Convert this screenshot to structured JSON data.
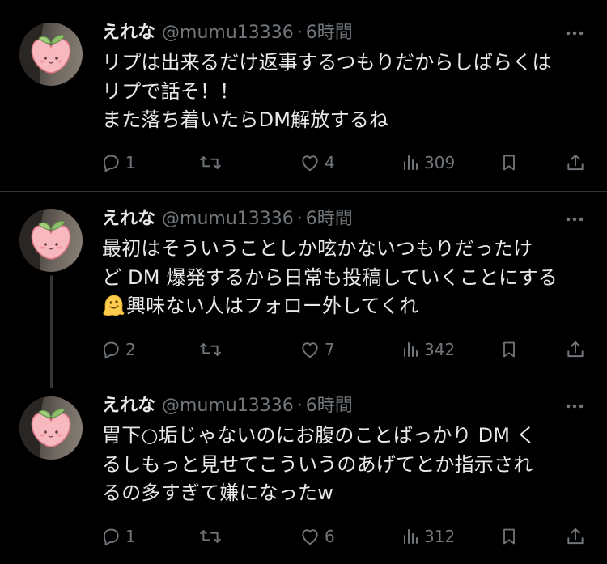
{
  "colors": {
    "background": "#000000",
    "text_primary": "#e7e9ea",
    "text_secondary": "#71767b",
    "divider": "#2f3336",
    "avatar_peach": "#f7b8c0"
  },
  "tweets": [
    {
      "name": "えれな",
      "handle": "@mumu13336",
      "separator": "·",
      "time": "6時間",
      "text": "リプは出来るだけ返事するつもりだからしばらくは\nリプで話そ！！\nまた落ち着いたらDM解放するね",
      "reply_count": "1",
      "retweet_count": "",
      "like_count": "4",
      "view_count": "309",
      "icons": [
        "reply-icon",
        "retweet-icon",
        "like-icon",
        "views-icon",
        "bookmark-icon",
        "share-icon",
        "more-icon"
      ]
    },
    {
      "name": "えれな",
      "handle": "@mumu13336",
      "separator": "·",
      "time": "6時間",
      "text_before_emoji": "最初はそういうことしか呟かないつもりだったけ\nど DM 爆発するから日常も投稿していくことにする\n",
      "emoji": "melting-face-emoji",
      "text_after_emoji": "興味ない人はフォロー外してくれ",
      "reply_count": "2",
      "retweet_count": "",
      "like_count": "7",
      "view_count": "342"
    },
    {
      "name": "えれな",
      "handle": "@mumu13336",
      "separator": "·",
      "time": "6時間",
      "text": "胃下○垢じゃないのにお腹のことばっかり DM く\nるしもっと見せてこういうのあげてとか指示され\nるの多すぎて嫌になったw",
      "reply_count": "1",
      "retweet_count": "",
      "like_count": "6",
      "view_count": "312"
    }
  ]
}
